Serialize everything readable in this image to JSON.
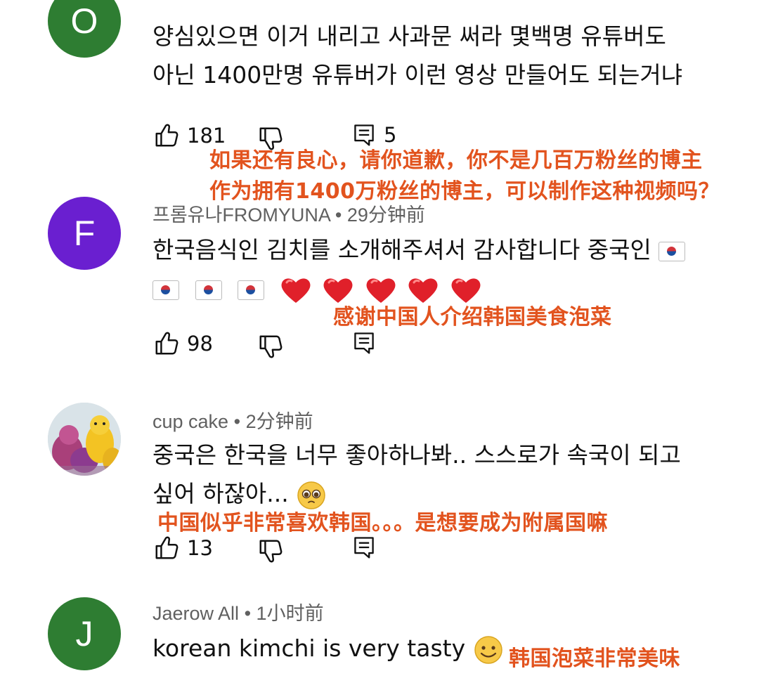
{
  "colors": {
    "translation": "#e2531e",
    "avatar_green": "#2e7d32",
    "avatar_purple": "#6a1fd0",
    "meta_gray": "#606060"
  },
  "comments": [
    {
      "avatar_letter": "O",
      "lines": [
        "양심있으면 이거 내리고 사과문 써라 몇백명 유튜버도",
        "아닌 1400만명 유튜버가 이런 영상 만들어도 되는거냐"
      ],
      "likes": "181",
      "replies": "5",
      "translation": [
        "如果还有良心，请你道歉，你不是几百万粉丝的博主",
        "作为拥有1400万粉丝的博主，可以制作这种视频吗？"
      ]
    },
    {
      "avatar_letter": "F",
      "author": "프롬유나FROMYUNA",
      "time": "29分钟前",
      "lines": [
        "한국음식인 김치를 소개해주셔서 감사합니다 중국인"
      ],
      "likes": "98",
      "translation": [
        "感谢中国人介绍韩国美食泡菜"
      ]
    },
    {
      "author": "cup cake",
      "time": "2分钟前",
      "lines": [
        "중국은 한국을 너무 좋아하나봐.. 스스로가 속국이 되고",
        "싶어 하잖아..."
      ],
      "likes": "13",
      "translation": [
        "中国似乎非常喜欢韩国。。。是想要成为附属国嘛"
      ]
    },
    {
      "avatar_letter": "J",
      "author": "Jaerow All",
      "time": "1小时前",
      "lines": [
        "korean kimchi is very tasty"
      ],
      "translation": [
        "韩国泡菜非常美味"
      ]
    }
  ],
  "separator": "•",
  "icons": [
    "thumbs-up-icon",
    "thumbs-down-icon",
    "reply-icon",
    "korean-flag-icon",
    "red-heart-icon",
    "pleading-face-emoji",
    "smiling-face-emoji"
  ]
}
